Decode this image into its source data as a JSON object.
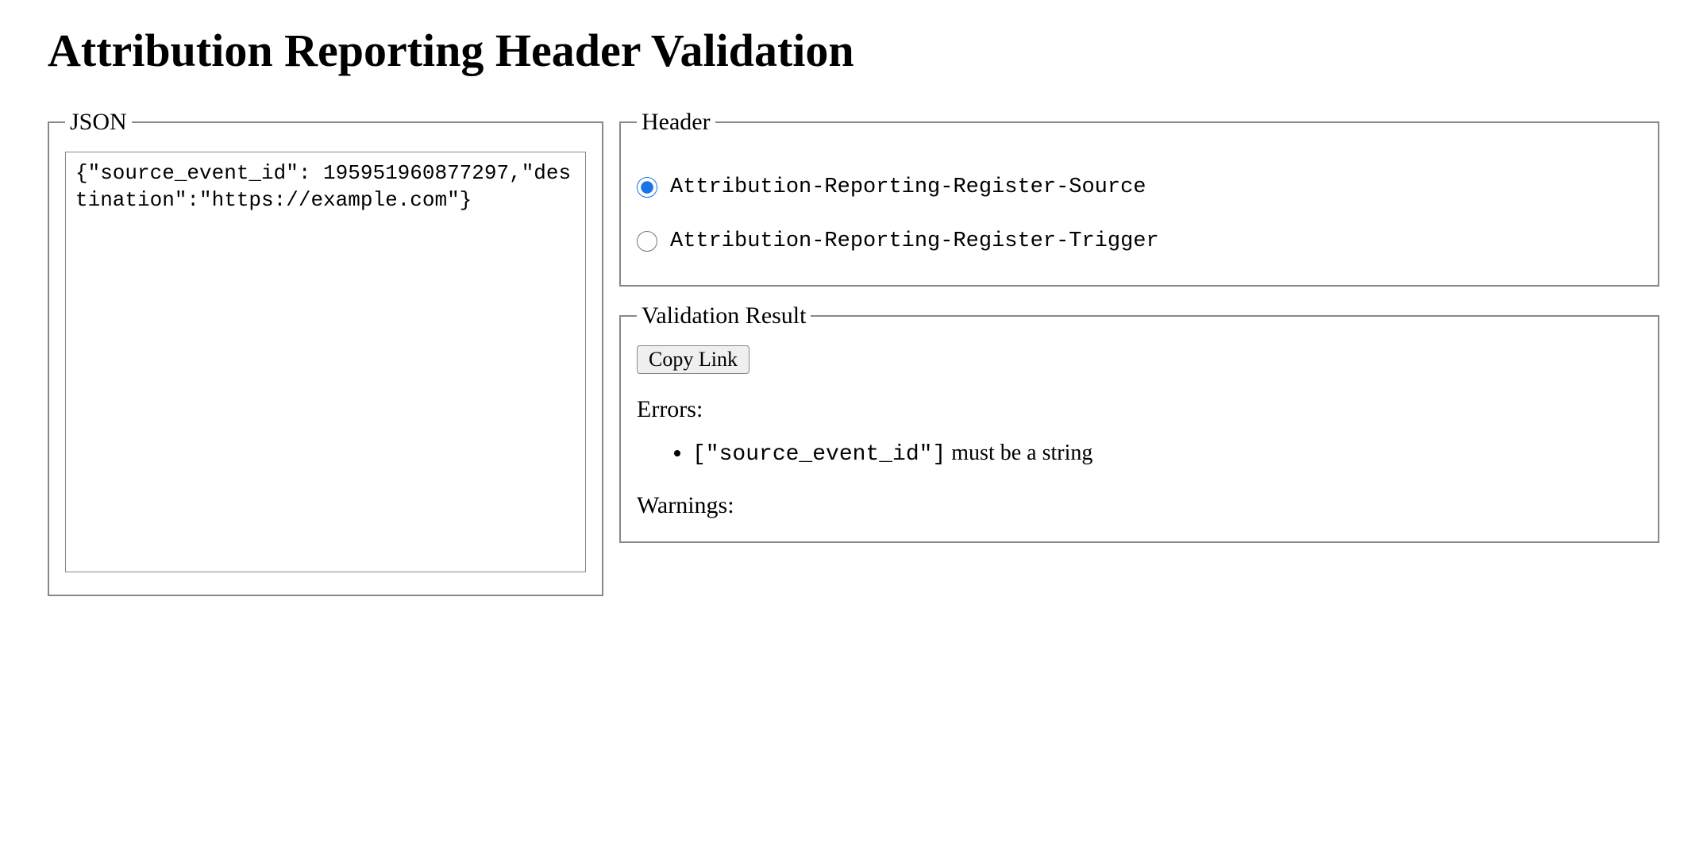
{
  "page": {
    "title": "Attribution Reporting Header Validation"
  },
  "json_panel": {
    "legend": "JSON",
    "value": "{\"source_event_id\": 195951960877297,\"destination\":\"https://example.com\"}"
  },
  "header_panel": {
    "legend": "Header",
    "options": [
      {
        "label": "Attribution-Reporting-Register-Source",
        "checked": true
      },
      {
        "label": "Attribution-Reporting-Register-Trigger",
        "checked": false
      }
    ]
  },
  "result_panel": {
    "legend": "Validation Result",
    "copy_button_label": "Copy Link",
    "errors_label": "Errors:",
    "errors": [
      {
        "path": "[\"source_event_id\"]",
        "message": " must be a string"
      }
    ],
    "warnings_label": "Warnings:",
    "warnings": []
  }
}
